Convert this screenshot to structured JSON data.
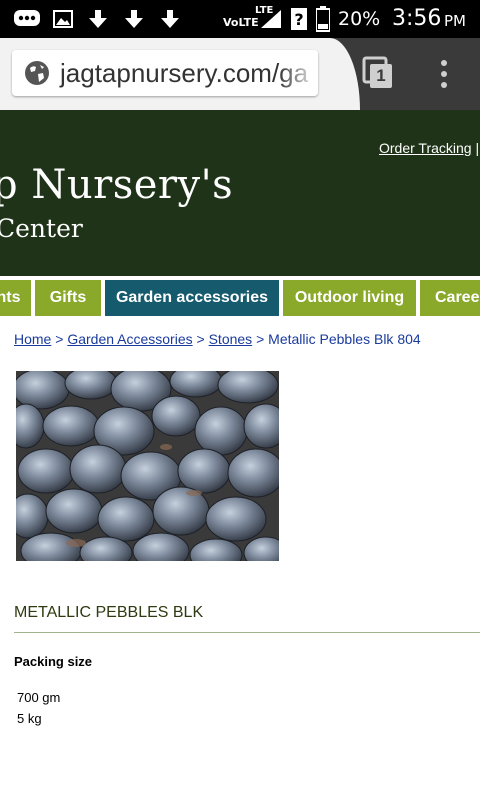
{
  "status_bar": {
    "carrier_label": "VoLTE",
    "network_label": "LTE",
    "battery_percent": "20%",
    "time": "3:56",
    "ampm": "PM",
    "icons": [
      "bbm-icon",
      "image-icon",
      "download-icon",
      "download-icon",
      "download-icon",
      "signal-icon",
      "unknown-sim-icon",
      "battery-icon"
    ]
  },
  "browser": {
    "url": "jagtapnursery.com/ga",
    "tab_count": "1"
  },
  "header": {
    "order_tracking": "Order Tracking",
    "separator": " |",
    "brand_title": "p Nursery's",
    "brand_subtitle": "Center"
  },
  "nav": {
    "items": [
      {
        "label": "nts"
      },
      {
        "label": "Gifts"
      },
      {
        "label": "Garden accessories"
      },
      {
        "label": "Outdoor living"
      },
      {
        "label": "Career"
      }
    ]
  },
  "breadcrumb": {
    "home": "Home",
    "garden_accessories": "Garden Accessories",
    "stones": "Stones",
    "current": "Metallic Pebbles Blk 804",
    "sep": ">"
  },
  "product": {
    "title": "METALLIC PEBBLES BLK",
    "packing_label": "Packing size",
    "packing_sizes": [
      "700 gm",
      "5 kg"
    ]
  },
  "colors": {
    "header_bg": "#1f3318",
    "nav_green": "#8aa829",
    "nav_active": "#165a6e",
    "link_blue": "#1a3b9c"
  }
}
